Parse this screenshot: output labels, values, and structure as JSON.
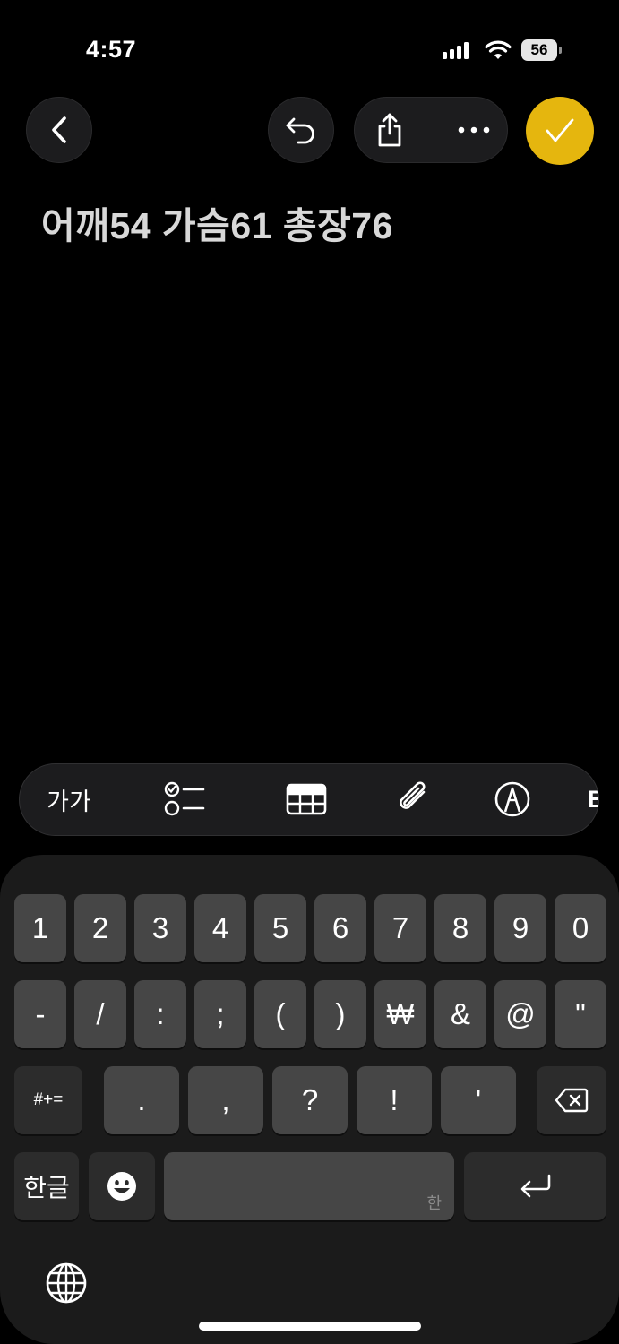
{
  "status_bar": {
    "time": "4:57",
    "battery": "56"
  },
  "note": {
    "text": "어깨54 가슴61 총장76"
  },
  "toolbar": {
    "text_style_label": "가가",
    "partial_label": "E"
  },
  "keyboard": {
    "row1": [
      "1",
      "2",
      "3",
      "4",
      "5",
      "6",
      "7",
      "8",
      "9",
      "0"
    ],
    "row2": [
      "-",
      "/",
      ":",
      ";",
      "(",
      ")",
      "₩",
      "&",
      "@",
      "\""
    ],
    "row3": {
      "symbols_label": "#+=",
      "keys": [
        ".",
        ",",
        "?",
        "!",
        "'"
      ]
    },
    "row4": {
      "hangul_label": "한글",
      "space_hint": "한"
    }
  },
  "colors": {
    "accent": "#e5b60e",
    "key": "#464646",
    "key_dark": "#2c2c2c",
    "keyboard_bg": "#1b1b1b"
  }
}
